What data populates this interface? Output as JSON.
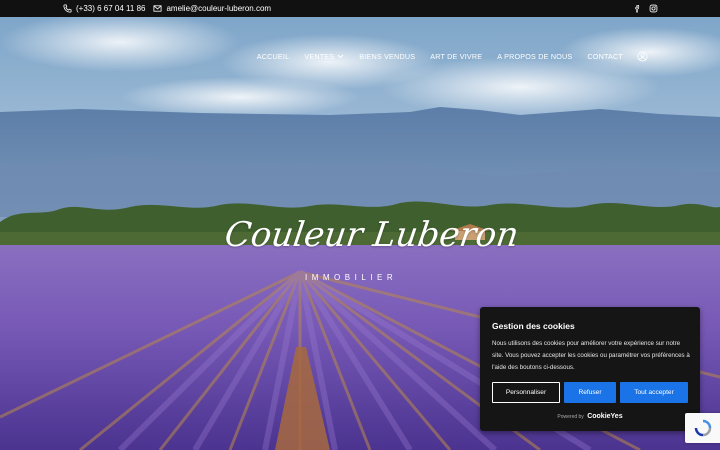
{
  "topbar": {
    "phone": "(+33) 6 67 04 11 86",
    "email": "amelie@couleur-luberon.com",
    "social_icons": [
      "facebook-icon",
      "instagram-icon"
    ]
  },
  "nav": {
    "items": [
      {
        "label": "ACCUEIL"
      },
      {
        "label": "VENTES"
      },
      {
        "label": "BIENS VENDUS"
      },
      {
        "label": "ART DE VIVRE"
      },
      {
        "label": "A PROPOS DE NOUS"
      },
      {
        "label": "CONTACT"
      }
    ],
    "account_icon": "user-circle-icon"
  },
  "hero": {
    "logo_script": "Couleur Luberon",
    "logo_sub": "IMMOBILIER"
  },
  "cookie": {
    "title": "Gestion des cookies",
    "text": "Nous utilisons des cookies pour améliorer votre expérience sur notre site. Vous pouvez accepter les cookies ou paramétrer vos préférences à l'aide des boutons ci-dessous.",
    "btn_customize": "Personnaliser",
    "btn_refuse": "Refuser",
    "btn_accept": "Tout accepter",
    "powered_by": "Powered by",
    "brand": "CookieYes",
    "accent_color": "#1a74e8"
  }
}
